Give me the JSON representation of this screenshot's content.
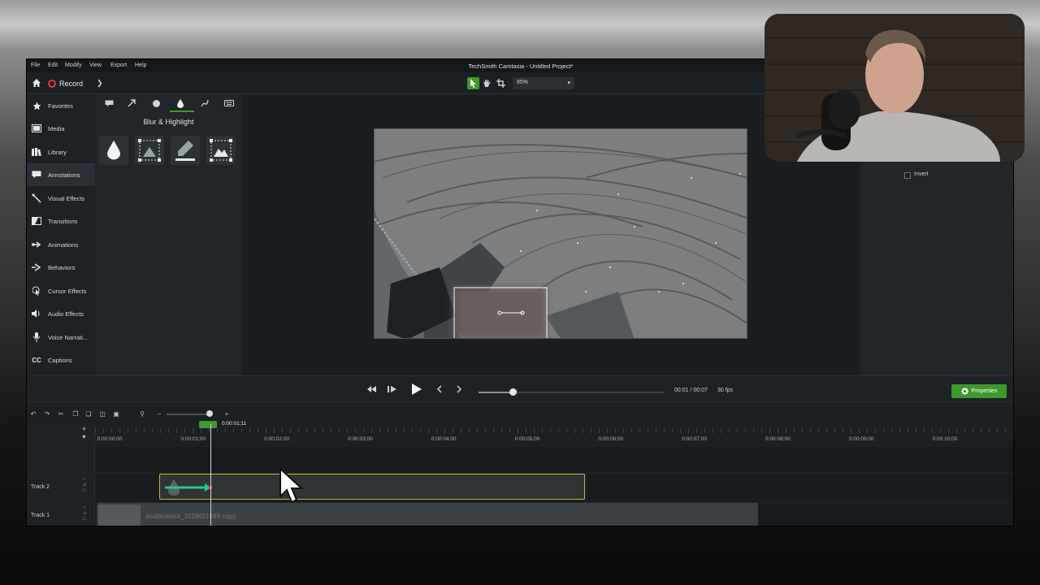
{
  "window": {
    "title": "TechSmith Camtasia - Untitled Project*"
  },
  "menu": [
    "File",
    "Edit",
    "Modify",
    "View",
    "Export",
    "Help"
  ],
  "toolbar": {
    "record_label": "Record",
    "zoom": "85%"
  },
  "sidebar": {
    "items": [
      {
        "label": "Favorites",
        "icon": "star-icon"
      },
      {
        "label": "Media",
        "icon": "film-icon"
      },
      {
        "label": "Library",
        "icon": "books-icon"
      },
      {
        "label": "Annotations",
        "icon": "speech-bubble-icon",
        "active": true
      },
      {
        "label": "Visual Effects",
        "icon": "wand-icon"
      },
      {
        "label": "Transitions",
        "icon": "transition-icon"
      },
      {
        "label": "Animations",
        "icon": "arrow-right-icon"
      },
      {
        "label": "Behaviors",
        "icon": "behaviors-icon"
      },
      {
        "label": "Cursor Effects",
        "icon": "cursor-icon"
      },
      {
        "label": "Audio Effects",
        "icon": "speaker-icon"
      },
      {
        "label": "Voice Narrati...",
        "icon": "microphone-icon"
      },
      {
        "label": "Captions",
        "icon": "cc-icon"
      }
    ]
  },
  "annotations_panel": {
    "title": "Blur & Highlight",
    "tabs": [
      "callout-icon",
      "arrow-icon",
      "shape-icon",
      "drop-icon",
      "sketch-icon",
      "keyboard-icon"
    ],
    "active_tab": 3,
    "thumbnails": [
      "blur-drop-icon",
      "pixelate-icon",
      "highlight-pen-icon",
      "spotlight-icon"
    ]
  },
  "properties_panel": {
    "invert_label": "Invert"
  },
  "playback": {
    "time": "00:01 / 00:07",
    "fps": "30 fps",
    "properties_label": "Properties",
    "position": 0.18
  },
  "timeline": {
    "playhead_time": "0:00:01;11",
    "ticks": [
      "0:00:00;00",
      "0:00:01;00",
      "0:00:02;00",
      "0:00:03;00",
      "0:00:04;00",
      "0:00:05;00",
      "0:00:06;00",
      "0:00:07;00",
      "0:00:08;00",
      "0:00:09;00",
      "0:00:10;00"
    ],
    "tracks": [
      {
        "name": "Track 2"
      },
      {
        "name": "Track 1",
        "clip": "shutterstock_1018601089 copy"
      }
    ]
  },
  "colors": {
    "accent": "#3d9a2d",
    "record": "#e2363f",
    "clip_border": "#c9b53a"
  }
}
